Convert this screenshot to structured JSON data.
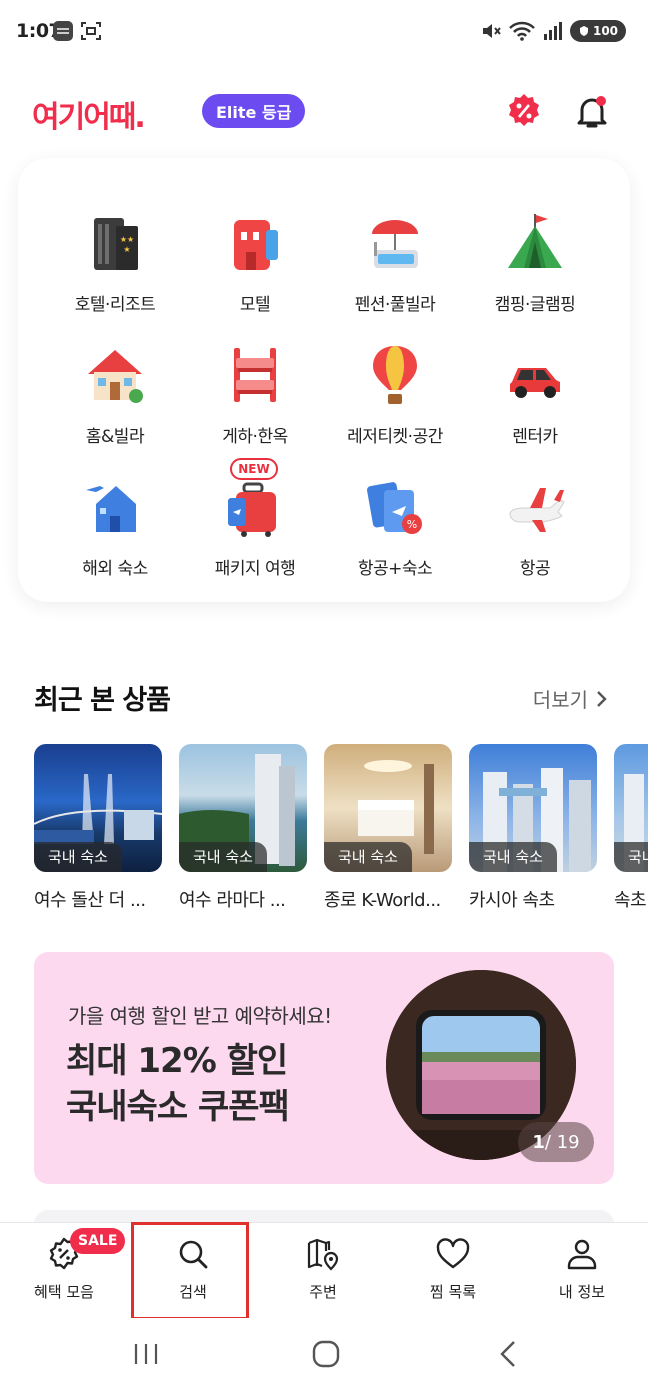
{
  "status_bar": {
    "time": "1:07",
    "battery": "100"
  },
  "header": {
    "logo_text": "여기어때.",
    "grade_label": "Elite 등급"
  },
  "categories": [
    {
      "label": "호텔·리조트",
      "icon": "hotel-building-icon"
    },
    {
      "label": "모텔",
      "icon": "motel-icon"
    },
    {
      "label": "펜션·풀빌라",
      "icon": "pool-villa-icon"
    },
    {
      "label": "캠핑·글램핑",
      "icon": "camping-tent-icon"
    },
    {
      "label": "홈&빌라",
      "icon": "house-icon"
    },
    {
      "label": "게하·한옥",
      "icon": "bunk-bed-icon"
    },
    {
      "label": "레저티켓·공간",
      "icon": "hot-air-balloon-icon"
    },
    {
      "label": "렌터카",
      "icon": "rental-car-icon"
    },
    {
      "label": "해외 숙소",
      "icon": "overseas-house-icon"
    },
    {
      "label": "패키지 여행",
      "icon": "luggage-icon",
      "badge": "NEW"
    },
    {
      "label": "항공+숙소",
      "icon": "flight-hotel-icon"
    },
    {
      "label": "항공",
      "icon": "airplane-icon"
    }
  ],
  "recent": {
    "title": "최근 본 상품",
    "more_label": "더보기",
    "items": [
      {
        "tag": "국내 숙소",
        "name": "여수 돌산 더 ..."
      },
      {
        "tag": "국내 숙소",
        "name": "여수 라마다 ..."
      },
      {
        "tag": "국내 숙소",
        "name": "종로 K-World..."
      },
      {
        "tag": "국내 숙소",
        "name": "카시아 속초"
      },
      {
        "tag": "국내 숙소",
        "name": "속초"
      }
    ]
  },
  "banner": {
    "subtitle": "가을 여행 할인 받고 예약하세요!",
    "title_line1": "최대 12% 할인",
    "title_line2": "국내숙소 쿠폰팩",
    "page_current": "1",
    "page_total": " / 19"
  },
  "bottom_nav": [
    {
      "label": "혜택 모음",
      "icon": "benefit-badge-icon",
      "badge": "SALE"
    },
    {
      "label": "검색",
      "icon": "search-icon"
    },
    {
      "label": "주변",
      "icon": "map-pin-icon"
    },
    {
      "label": "찜 목록",
      "icon": "heart-icon"
    },
    {
      "label": "내 정보",
      "icon": "person-icon"
    }
  ],
  "colors": {
    "brand": "#f02e4b",
    "grade": "#6c4cf0",
    "banner_bg": "#fcd9ef"
  }
}
